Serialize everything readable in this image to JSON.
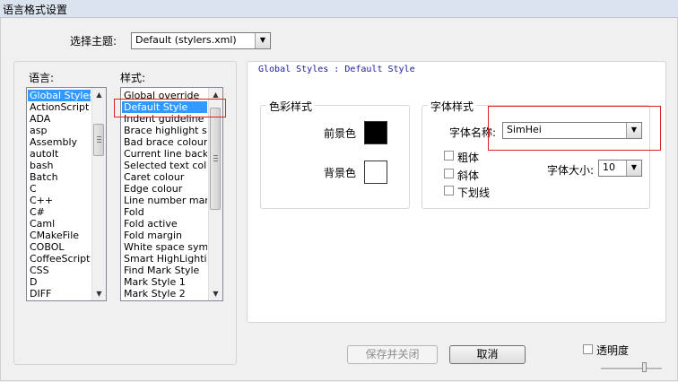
{
  "window": {
    "title": "语言格式设置"
  },
  "theme": {
    "label": "选择主题:",
    "value": "Default (stylers.xml)"
  },
  "languages": {
    "label": "语言:",
    "items": [
      "Global Styles",
      "ActionScript",
      "ADA",
      "asp",
      "Assembly",
      "autoIt",
      "bash",
      "Batch",
      "C",
      "C++",
      "C#",
      "Caml",
      "CMakeFile",
      "COBOL",
      "CoffeeScript",
      "CSS",
      "D",
      "DIFF"
    ],
    "selected": "Global Styles"
  },
  "styles": {
    "label": "样式:",
    "items": [
      "Global override",
      "Default Style",
      "Indent guideline style",
      "Brace highlight style",
      "Bad brace colour",
      "Current line background colour",
      "Selected text colour",
      "Caret colour",
      "Edge colour",
      "Line number margin",
      "Fold",
      "Fold active",
      "Fold margin",
      "White space symbol",
      "Smart HighLighting",
      "Find Mark Style",
      "Mark Style 1",
      "Mark Style 2"
    ],
    "selected": "Default Style"
  },
  "path": "Global Styles : Default Style",
  "color_style": {
    "title": "色彩样式",
    "fg_label": "前景色",
    "bg_label": "背景色",
    "fg_color": "#000000",
    "bg_color": "#ffffff"
  },
  "font_style": {
    "title": "字体样式",
    "name_label": "字体名称:",
    "name_value": "SimHei",
    "bold_label": "粗体",
    "italic_label": "斜体",
    "underline_label": "下划线",
    "size_label": "字体大小:",
    "size_value": "10"
  },
  "buttons": {
    "save_close": "保存并关闭",
    "cancel": "取消"
  },
  "transparency": {
    "label": "透明度"
  },
  "colors": {
    "selection": "#3399ff",
    "highlight_box": "#e02020",
    "path_text": "#1a1aa0"
  }
}
